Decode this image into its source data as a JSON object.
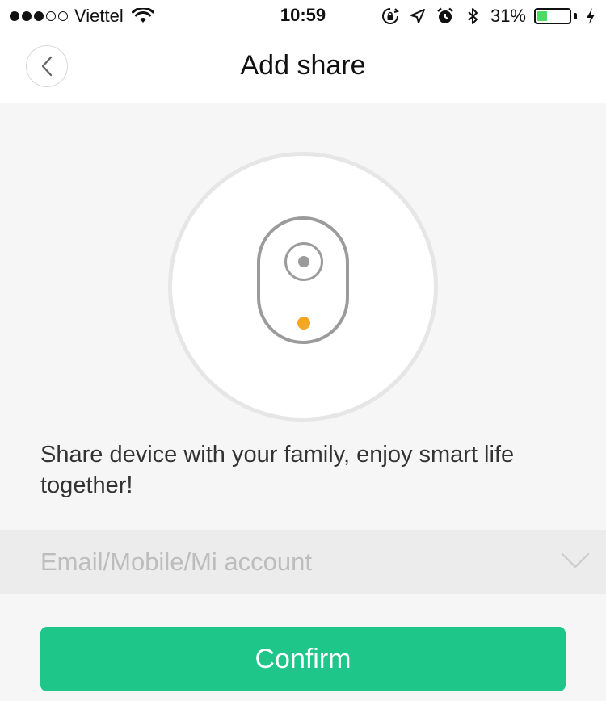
{
  "status_bar": {
    "carrier": "Viettel",
    "time": "10:59",
    "battery_percent": "31%",
    "battery_level": 0.31,
    "signal_bars_filled": 3,
    "signal_bars_total": 5,
    "icons": [
      "wifi-icon",
      "rotation-lock-icon",
      "location-arrow-icon",
      "alarm-icon",
      "bluetooth-icon",
      "battery-icon",
      "charging-bolt-icon"
    ],
    "battery_color": "#4cd964"
  },
  "header": {
    "title": "Add share",
    "back_icon": "chevron-left-icon"
  },
  "illustration": {
    "icon": "smart-camera-device-icon",
    "led_color": "#f5a623"
  },
  "description": "Share device with your family, enjoy smart life together!",
  "account_input": {
    "placeholder": "Email/Mobile/Mi account",
    "value": "",
    "dropdown_icon": "chevron-down-icon"
  },
  "confirm_button": {
    "label": "Confirm",
    "color": "#1fc689"
  }
}
